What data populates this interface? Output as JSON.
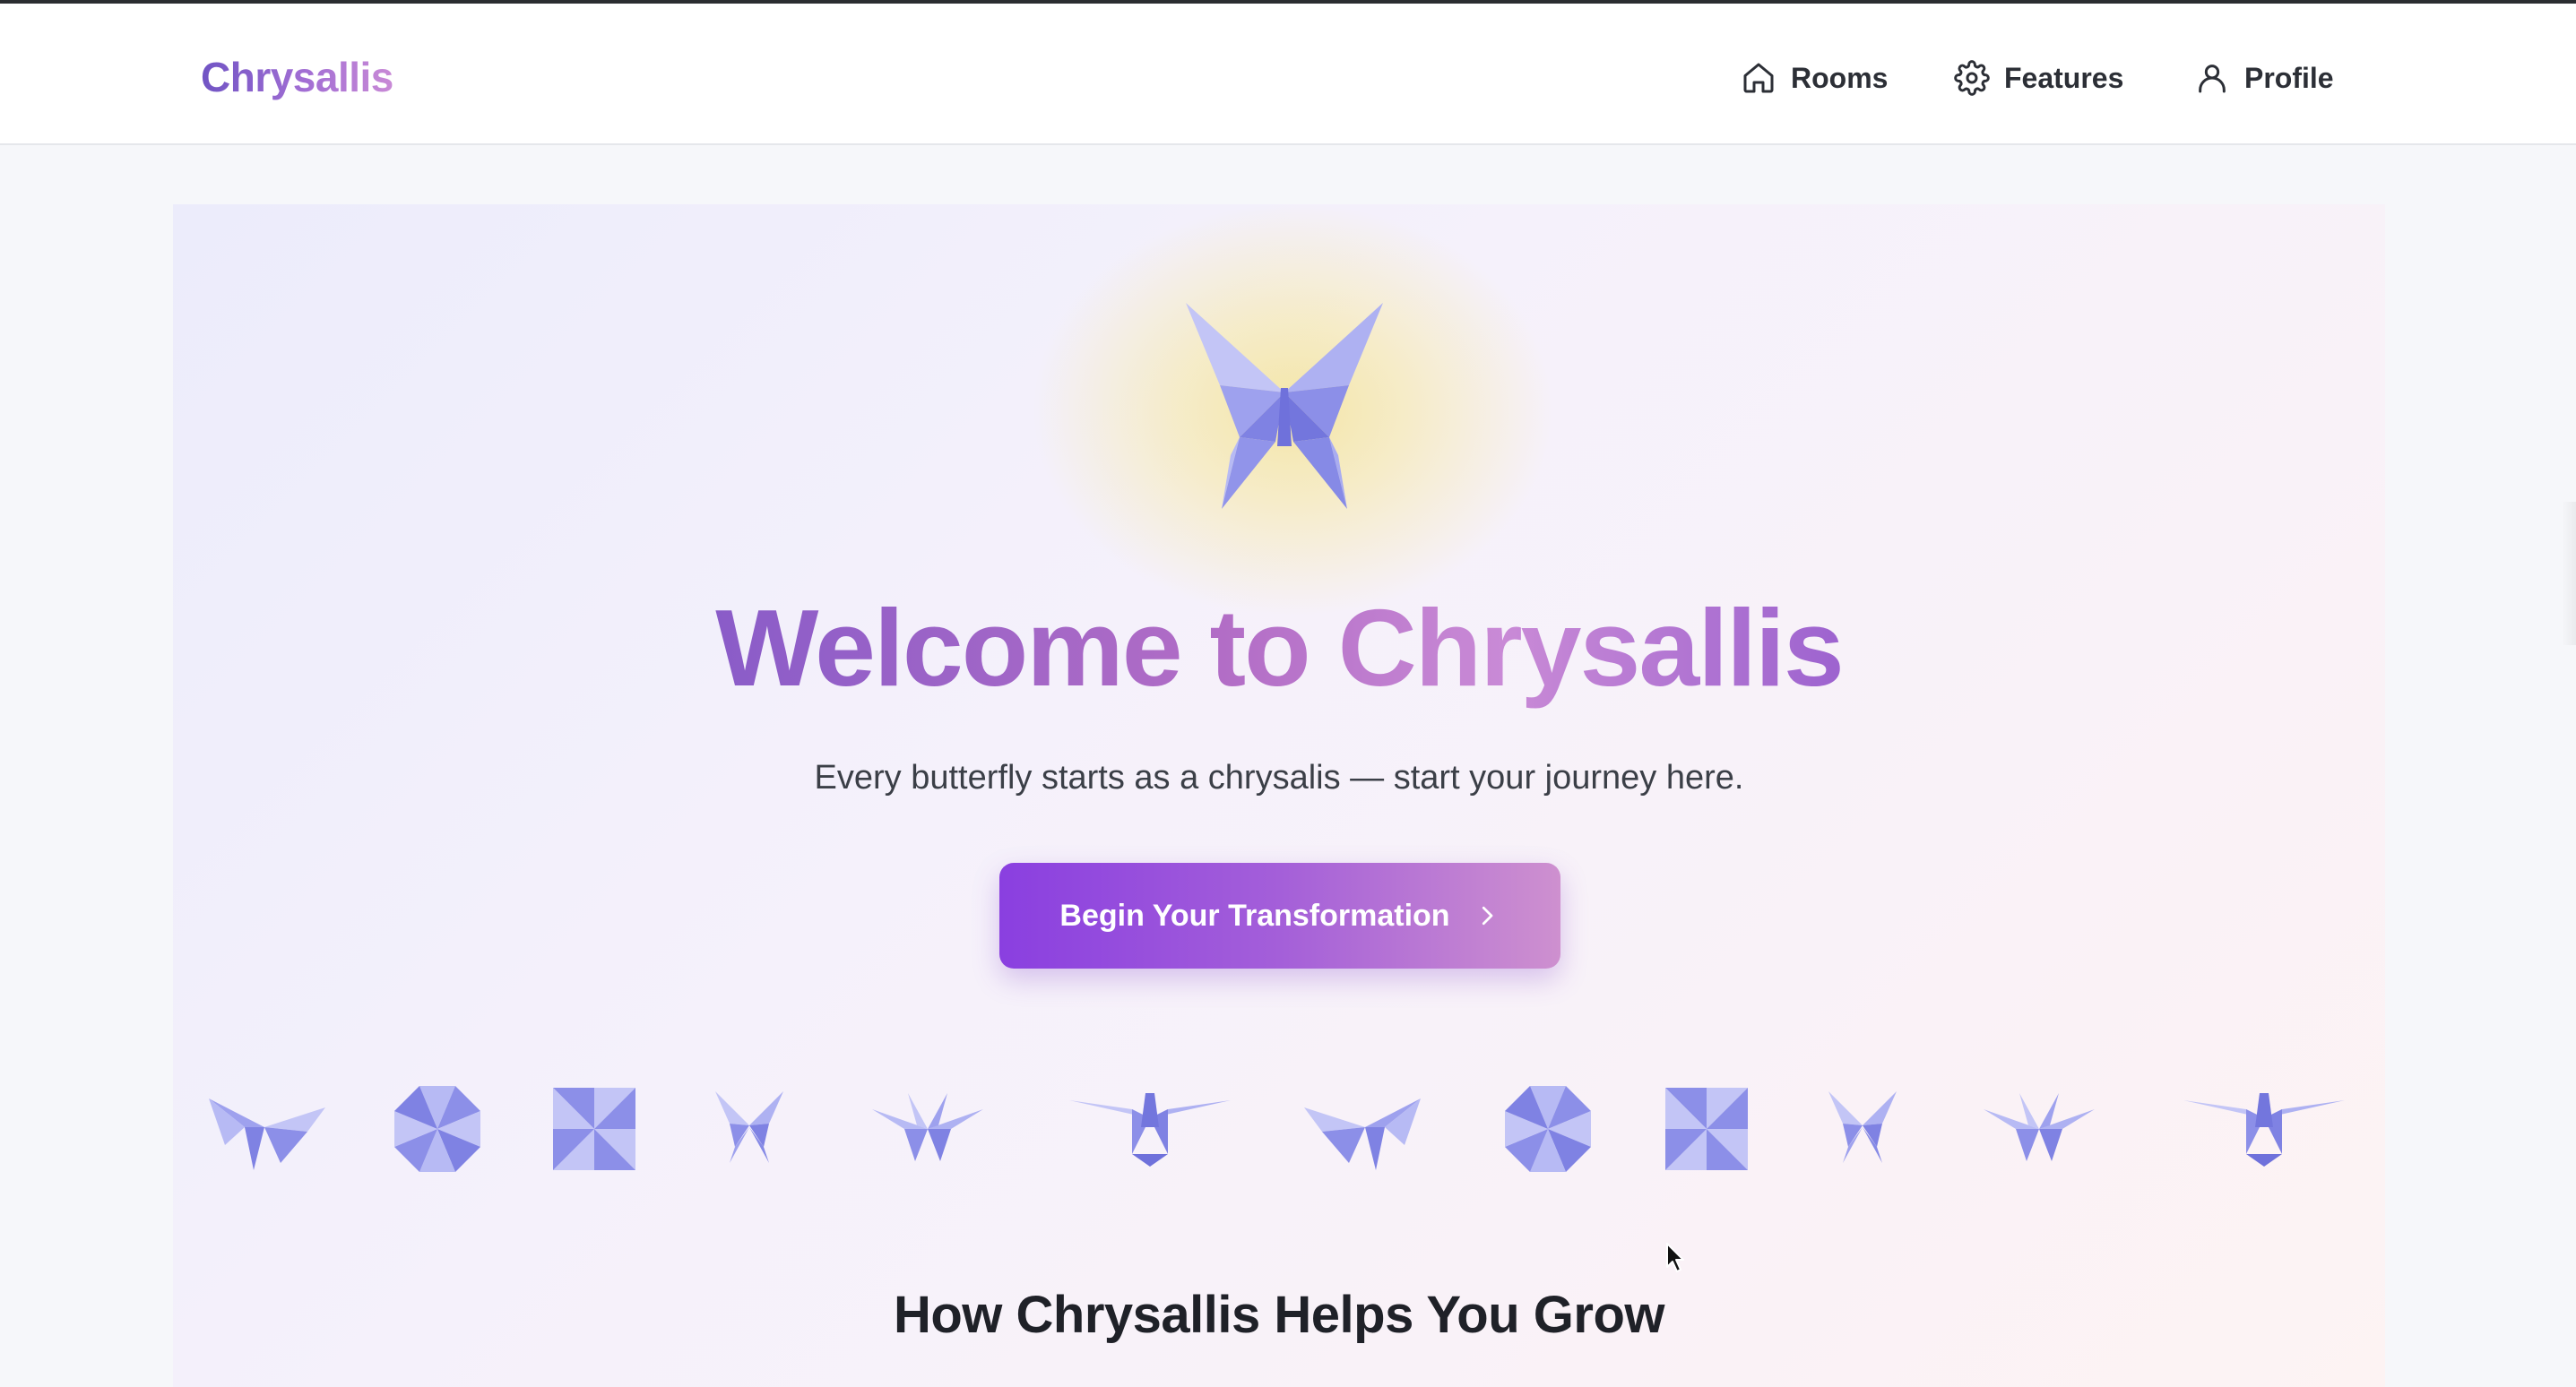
{
  "navbar": {
    "brand": "Chrysallis",
    "items": [
      {
        "label": "Rooms",
        "icon": "home-icon"
      },
      {
        "label": "Features",
        "icon": "gear-icon"
      },
      {
        "label": "Profile",
        "icon": "user-icon"
      }
    ]
  },
  "hero": {
    "icon": "origami-butterfly-icon",
    "title": "Welcome to Chrysallis",
    "subtitle": "Every butterfly starts as a chrysalis — start your journey here.",
    "cta_label": "Begin Your Transformation",
    "cta_icon": "chevron-right-icon"
  },
  "origami_strip": [
    "origami-butterfly-icon",
    "origami-octagon-icon",
    "origami-square-icon",
    "origami-butterfly-icon",
    "origami-butterfly-icon",
    "origami-bird-icon",
    "origami-butterfly-icon",
    "origami-octagon-icon",
    "origami-square-icon",
    "origami-butterfly-icon",
    "origami-butterfly-icon",
    "origami-bird-icon"
  ],
  "section": {
    "heading": "How Chrysallis Helps You Grow"
  },
  "colors": {
    "accent_purple": "#8a3fe0",
    "accent_pink": "#ce90cf",
    "origami_light": "#b9bcf4",
    "origami_mid": "#8f92ea",
    "origami_dark": "#6f71db",
    "glow": "#f4e5a3"
  }
}
